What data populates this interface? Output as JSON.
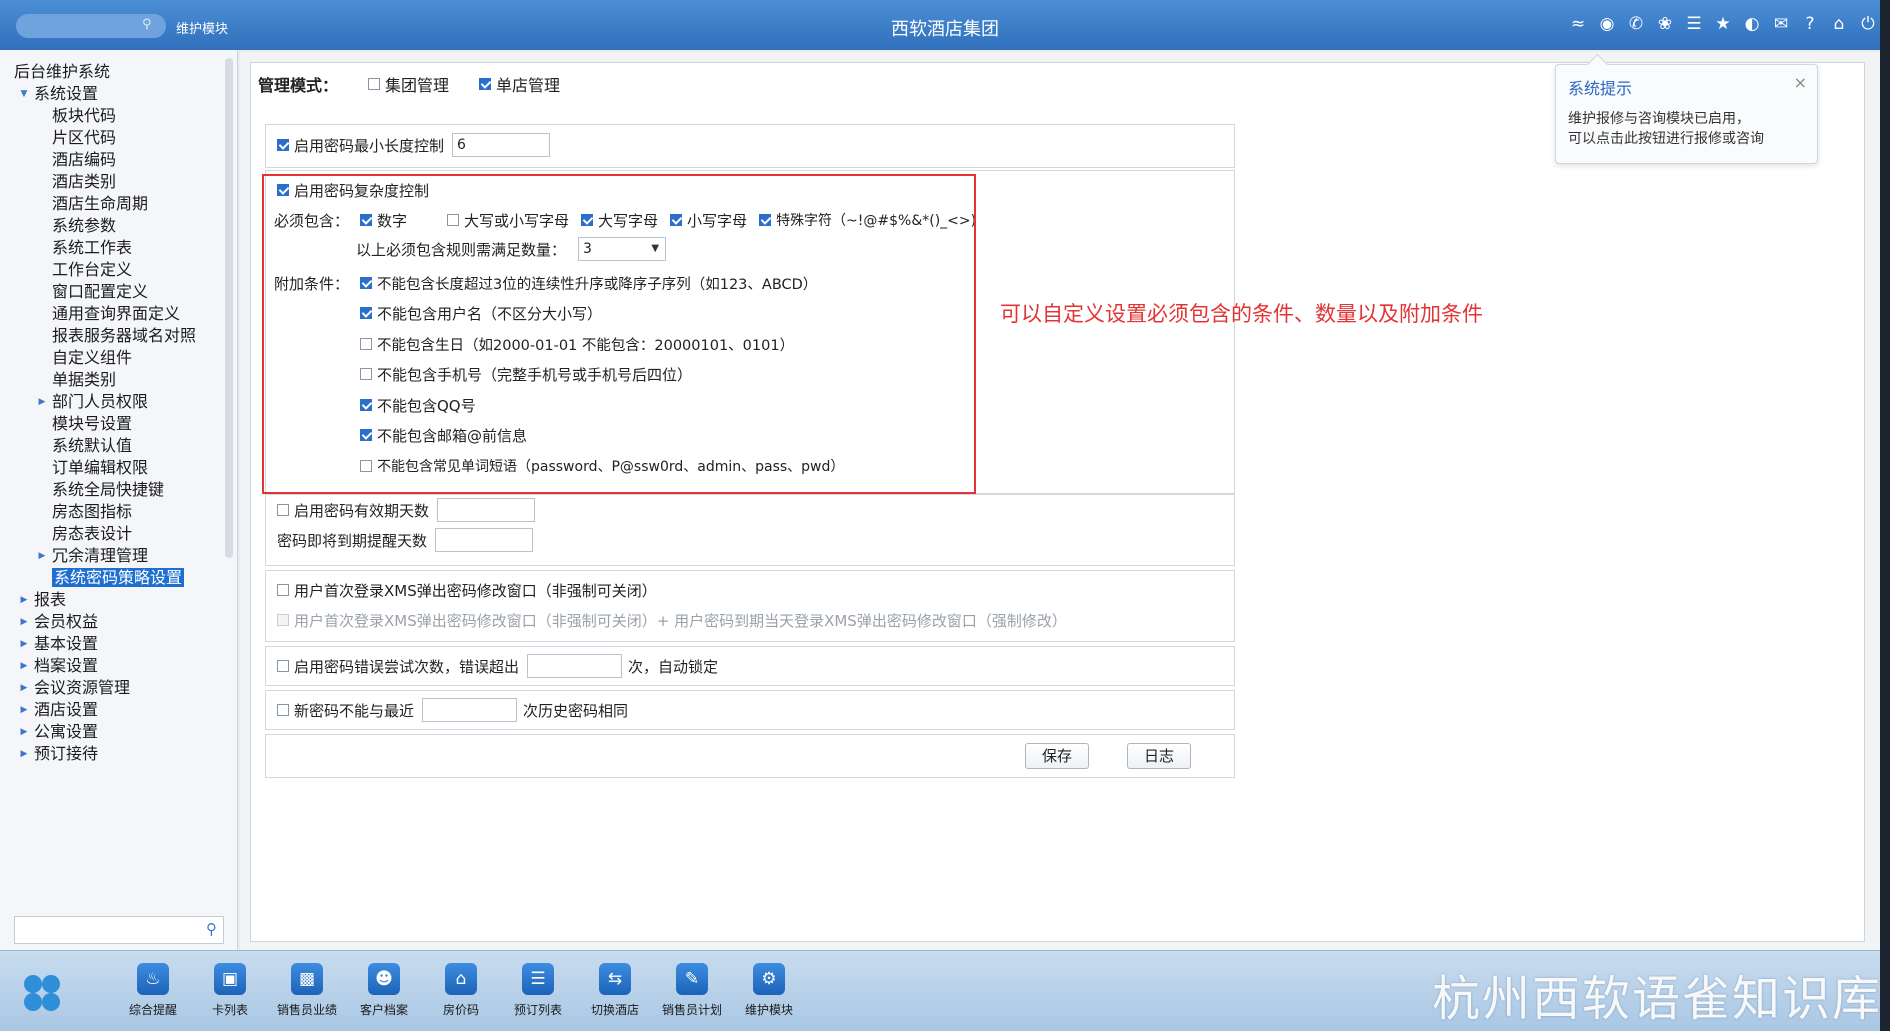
{
  "titlebar": {
    "module_label": "维护模块",
    "app_title": "西软酒店集团",
    "icons": [
      "wifi-icon",
      "chat-icon",
      "phone-icon",
      "palette-icon",
      "menu-icon",
      "star-icon",
      "moon-icon",
      "mail-icon",
      "help-icon",
      "home-icon",
      "power-icon"
    ]
  },
  "sidebar": {
    "root": "后台维护系统",
    "items": [
      {
        "label": "系统设置",
        "level": 1,
        "arrow": "expanded"
      },
      {
        "label": "板块代码",
        "level": 2
      },
      {
        "label": "片区代码",
        "level": 2
      },
      {
        "label": "酒店编码",
        "level": 2
      },
      {
        "label": "酒店类别",
        "level": 2
      },
      {
        "label": "酒店生命周期",
        "level": 2
      },
      {
        "label": "系统参数",
        "level": 2
      },
      {
        "label": "系统工作表",
        "level": 2
      },
      {
        "label": "工作台定义",
        "level": 2
      },
      {
        "label": "窗口配置定义",
        "level": 2
      },
      {
        "label": "通用查询界面定义",
        "level": 2
      },
      {
        "label": "报表服务器域名对照",
        "level": 2
      },
      {
        "label": "自定义组件",
        "level": 2
      },
      {
        "label": "单据类别",
        "level": 2
      },
      {
        "label": "部门人员权限",
        "level": 2,
        "arrow": "collapsed"
      },
      {
        "label": "模块号设置",
        "level": 2
      },
      {
        "label": "系统默认值",
        "level": 2
      },
      {
        "label": "订单编辑权限",
        "level": 2
      },
      {
        "label": "系统全局快捷键",
        "level": 2
      },
      {
        "label": "房态图指标",
        "level": 2
      },
      {
        "label": "房态表设计",
        "level": 2
      },
      {
        "label": "冗余清理管理",
        "level": 2,
        "arrow": "collapsed"
      },
      {
        "label": "系统密码策略设置",
        "level": 2,
        "selected": true
      },
      {
        "label": "报表",
        "level": 1,
        "arrow": "collapsed"
      },
      {
        "label": "会员权益",
        "level": 1,
        "arrow": "collapsed"
      },
      {
        "label": "基本设置",
        "level": 1,
        "arrow": "collapsed"
      },
      {
        "label": "档案设置",
        "level": 1,
        "arrow": "collapsed"
      },
      {
        "label": "会议资源管理",
        "level": 1,
        "arrow": "collapsed"
      },
      {
        "label": "酒店设置",
        "level": 1,
        "arrow": "collapsed"
      },
      {
        "label": "公寓设置",
        "level": 1,
        "arrow": "collapsed"
      },
      {
        "label": "预订接待",
        "level": 1,
        "arrow": "collapsed"
      }
    ],
    "search_value": ""
  },
  "mode": {
    "label": "管理模式：",
    "group": {
      "label": "集团管理",
      "checked": false
    },
    "single": {
      "label": "单店管理",
      "checked": true
    }
  },
  "min_length": {
    "label": "启用密码最小长度控制",
    "checked": true,
    "value": "6"
  },
  "complexity": {
    "label": "启用密码复杂度控制",
    "checked": true,
    "must_include_label": "必须包含：",
    "options": [
      {
        "label": "数字",
        "checked": true
      },
      {
        "label": "大写或小写字母",
        "checked": false
      },
      {
        "label": "大写字母",
        "checked": true
      },
      {
        "label": "小写字母",
        "checked": true
      },
      {
        "label": "特殊字符（~!@#$%&*()_<>)",
        "checked": true
      }
    ],
    "count_label": "以上必须包含规则需满足数量：",
    "count_value": "3",
    "extra_label": "附加条件：",
    "extra": [
      {
        "label": "不能包含长度超过3位的连续性升序或降序子序列（如123、ABCD）",
        "checked": true
      },
      {
        "label": "不能包含用户名（不区分大小写）",
        "checked": true
      },
      {
        "label": "不能包含生日（如2000-01-01 不能包含：20000101、0101）",
        "checked": false
      },
      {
        "label": "不能包含手机号（完整手机号或手机号后四位）",
        "checked": false
      },
      {
        "label": "不能包含QQ号",
        "checked": true
      },
      {
        "label": "不能包含邮箱@前信息",
        "checked": true
      },
      {
        "label": "不能包含常见单词短语（password、P@ssw0rd、admin、pass、pwd）",
        "checked": false
      }
    ]
  },
  "annotation": "可以自定义设置必须包含的条件、数量以及附加条件",
  "validity": {
    "label": "启用密码有效期天数",
    "checked": false,
    "value": "",
    "remind_label": "密码即将到期提醒天数",
    "remind_value": ""
  },
  "first_login": {
    "label": "用户首次登录XMS弹出密码修改窗口（非强制可关闭）",
    "checked": false,
    "label2": "用户首次登录XMS弹出密码修改窗口（非强制可关闭）+ 用户密码到期当天登录XMS弹出密码修改窗口（强制修改）",
    "checked2": false
  },
  "lockout": {
    "label": "启用密码错误尝试次数，错误超出",
    "checked": false,
    "value": "",
    "suffix": "次，自动锁定"
  },
  "history": {
    "label": "新密码不能与最近",
    "checked": false,
    "value": "",
    "suffix": "次历史密码相同"
  },
  "buttons": {
    "save": "保存",
    "log": "日志"
  },
  "popup": {
    "title": "系统提示",
    "close": "×",
    "line1": "维护报修与咨询模块已启用，",
    "line2": "可以点击此按钮进行报修或咨询"
  },
  "taskbar": {
    "items": [
      {
        "label": "综合提醒",
        "icon": "bell-icon"
      },
      {
        "label": "卡列表",
        "icon": "card-icon"
      },
      {
        "label": "销售员业绩",
        "icon": "chart-icon"
      },
      {
        "label": "客户档案",
        "icon": "profile-icon"
      },
      {
        "label": "房价码",
        "icon": "house-icon"
      },
      {
        "label": "预订列表",
        "icon": "list-icon"
      },
      {
        "label": "切换酒店",
        "icon": "switch-icon"
      },
      {
        "label": "销售员计划",
        "icon": "edit-icon"
      },
      {
        "label": "维护模块",
        "icon": "wrench-icon"
      }
    ],
    "watermark": "杭州西软语雀知识库"
  }
}
